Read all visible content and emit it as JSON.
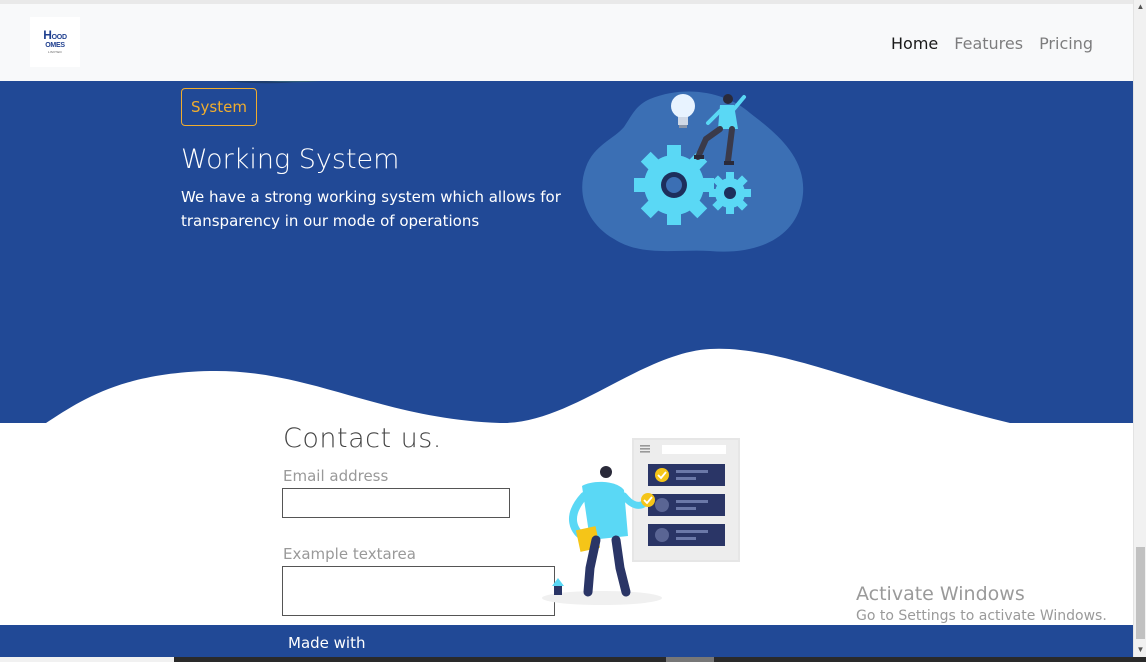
{
  "navbar": {
    "logo": {
      "line1": "OOD",
      "line1_initial": "H",
      "line2": "OMES",
      "sub": "LIMITED"
    },
    "links": [
      {
        "label": "Home",
        "active": true
      },
      {
        "label": "Features",
        "active": false
      },
      {
        "label": "Pricing",
        "active": false
      }
    ]
  },
  "hero": {
    "button_label": "System",
    "title": "Working System",
    "text": "We have a strong working system which allows for transparency in our mode of operations"
  },
  "contact": {
    "title": "Contact us.",
    "email_label": "Email address",
    "email_value": "",
    "textarea_label": "Example textarea",
    "textarea_value": ""
  },
  "watermark": {
    "title": "Activate Windows",
    "subtitle": "Go to Settings to activate Windows."
  },
  "footer": {
    "text": "Made with"
  },
  "colors": {
    "brand_blue": "#214996",
    "accent_yellow": "#f0ad2e",
    "illustration_cyan": "#5ad8f5"
  },
  "icons": [
    "gears-illustration",
    "lightbulb-icon",
    "person-illustration",
    "checklist-illustration"
  ]
}
